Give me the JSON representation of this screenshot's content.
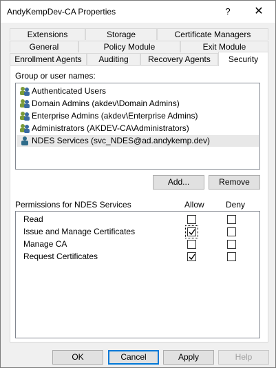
{
  "window": {
    "title": "AndyKempDev-CA Properties",
    "help_glyph": "?",
    "close_glyph": "✕"
  },
  "tabs": {
    "row1": [
      "Extensions",
      "Storage",
      "Certificate Managers"
    ],
    "row2": [
      "General",
      "Policy Module",
      "Exit Module"
    ],
    "row3": [
      "Enrollment Agents",
      "Auditing",
      "Recovery Agents",
      "Security"
    ],
    "active": "Security"
  },
  "security": {
    "group_label": "Group or user names:",
    "users": [
      {
        "name": "Authenticated Users",
        "icon": "group-icon"
      },
      {
        "name": "Domain Admins (akdev\\Domain Admins)",
        "icon": "group-icon"
      },
      {
        "name": "Enterprise Admins (akdev\\Enterprise Admins)",
        "icon": "group-icon"
      },
      {
        "name": "Administrators (AKDEV-CA\\Administrators)",
        "icon": "group-icon"
      },
      {
        "name": "NDES Services (svc_NDES@ad.andykemp.dev)",
        "icon": "user-icon",
        "selected": true
      }
    ],
    "add_label": "Add...",
    "remove_label": "Remove",
    "permissions_label": "Permissions for NDES Services",
    "allow_header": "Allow",
    "deny_header": "Deny",
    "permissions": [
      {
        "name": "Read",
        "allow": false,
        "deny": false
      },
      {
        "name": "Issue and Manage Certificates",
        "allow": true,
        "deny": false,
        "focused": true
      },
      {
        "name": "Manage CA",
        "allow": false,
        "deny": false
      },
      {
        "name": "Request Certificates",
        "allow": true,
        "deny": false
      }
    ]
  },
  "footer": {
    "ok": "OK",
    "cancel": "Cancel",
    "apply": "Apply",
    "help": "Help"
  }
}
